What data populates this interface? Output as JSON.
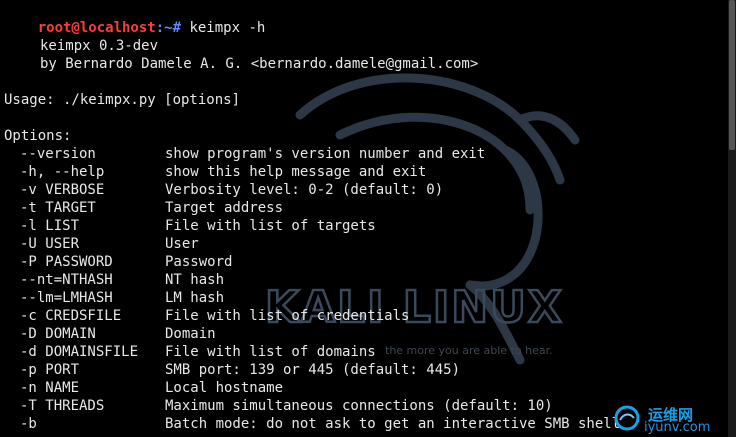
{
  "terminal": {
    "prompt_user": "root@localhost",
    "prompt_path": ":~# ",
    "command": "keimpx -h",
    "banner_name": "keimpx 0.3-dev",
    "banner_author": "by Bernardo Damele A. G. <bernardo.damele@gmail.com>",
    "usage": "Usage: ./keimpx.py [options]",
    "options_header": "Options:",
    "options": [
      {
        "flag": "--version",
        "desc": "show program's version number and exit"
      },
      {
        "flag": "-h, --help",
        "desc": "show this help message and exit"
      },
      {
        "flag": "-v VERBOSE",
        "desc": "Verbosity level: 0-2 (default: 0)"
      },
      {
        "flag": "-t TARGET",
        "desc": "Target address"
      },
      {
        "flag": "-l LIST",
        "desc": "File with list of targets"
      },
      {
        "flag": "-U USER",
        "desc": "User"
      },
      {
        "flag": "-P PASSWORD",
        "desc": "Password"
      },
      {
        "flag": "--nt=NTHASH",
        "desc": "NT hash"
      },
      {
        "flag": "--lm=LMHASH",
        "desc": "LM hash"
      },
      {
        "flag": "-c CREDSFILE",
        "desc": "File with list of credentials"
      },
      {
        "flag": "-D DOMAIN",
        "desc": "Domain"
      },
      {
        "flag": "-d DOMAINSFILE",
        "desc": "File with list of domains"
      },
      {
        "flag": "-p PORT",
        "desc": "SMB port: 139 or 445 (default: 445)"
      },
      {
        "flag": "-n NAME",
        "desc": "Local hostname"
      },
      {
        "flag": "-T THREADS",
        "desc": "Maximum simultaneous connections (default: 10)"
      },
      {
        "flag": "-b",
        "desc": "Batch mode: do not ask to get an interactive SMB shell"
      }
    ]
  },
  "wallpaper": {
    "title": "KALI LINUX",
    "tagline": "the more you are able to hear.",
    "color": "#3a4a5c"
  },
  "watermark": {
    "title": "运维网",
    "subtitle": "iyunv.com",
    "color": "#1aa0e8"
  }
}
